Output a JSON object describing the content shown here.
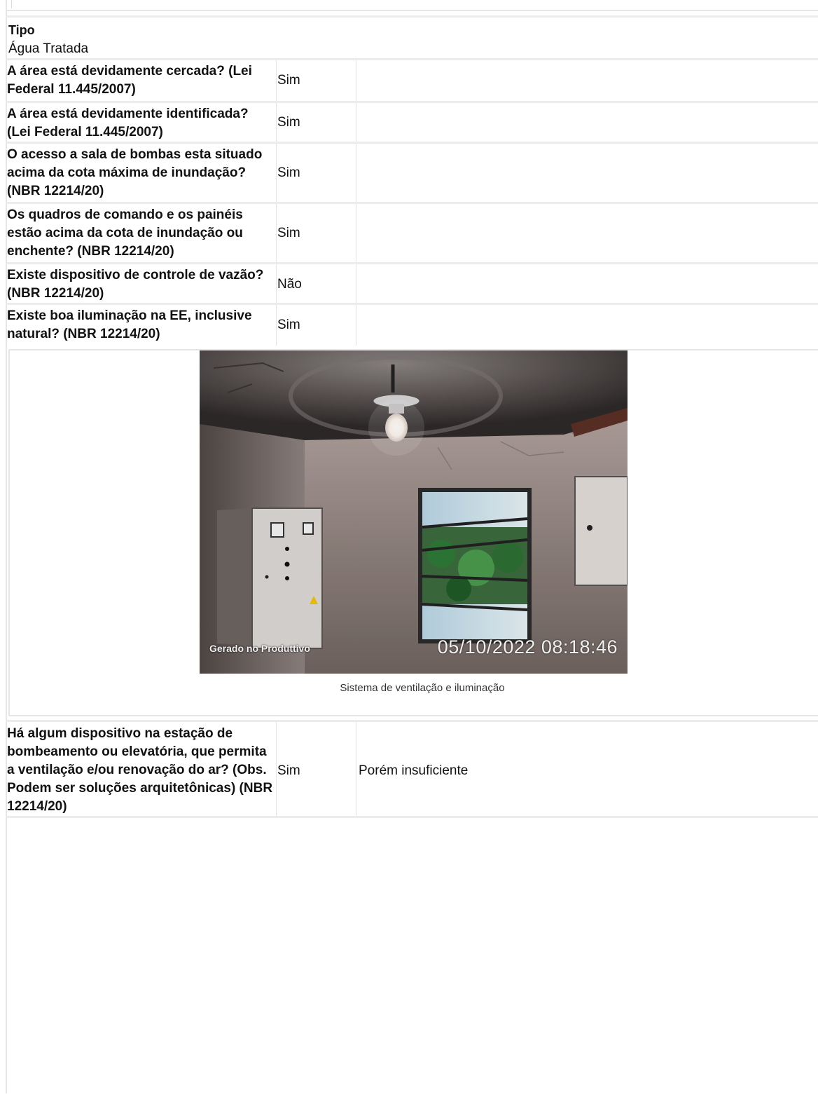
{
  "tipo": {
    "label": "Tipo",
    "value": "Água Tratada"
  },
  "rows": [
    {
      "question": "A área está devidamente cercada? (Lei Federal 11.445/2007)",
      "answer": "Sim",
      "note": ""
    },
    {
      "question": "A área está devidamente identificada? (Lei Federal 11.445/2007)",
      "answer": "Sim",
      "note": ""
    },
    {
      "question": "O acesso a sala de bombas esta situado acima da cota máxima de inundação? (NBR 12214/20)",
      "answer": "Sim",
      "note": ""
    },
    {
      "question": "Os quadros de comando e os painéis estão acima da cota de inundação ou enchente? (NBR 12214/20)",
      "answer": "Sim",
      "note": ""
    },
    {
      "question": "Existe dispositivo de controle de vazão? (NBR 12214/20)",
      "answer": "Não",
      "note": ""
    },
    {
      "question": "Existe boa iluminação na EE, inclusive natural? (NBR 12214/20)",
      "answer": "Sim",
      "note": ""
    },
    {
      "question": "Há algum dispositivo na estação de bombeamento ou elevatória, que permita a ventilação e/ou renovação do ar? (Obs. Podem ser soluções arquitetônicas) (NBR 12214/20)",
      "answer": "Sim",
      "note": "Porém insuficiente"
    }
  ],
  "photo": {
    "watermark_left": "Gerado no Produttivo",
    "watermark_right": "05/10/2022 08:18:46",
    "caption": "Sistema de ventilação e iluminação"
  }
}
